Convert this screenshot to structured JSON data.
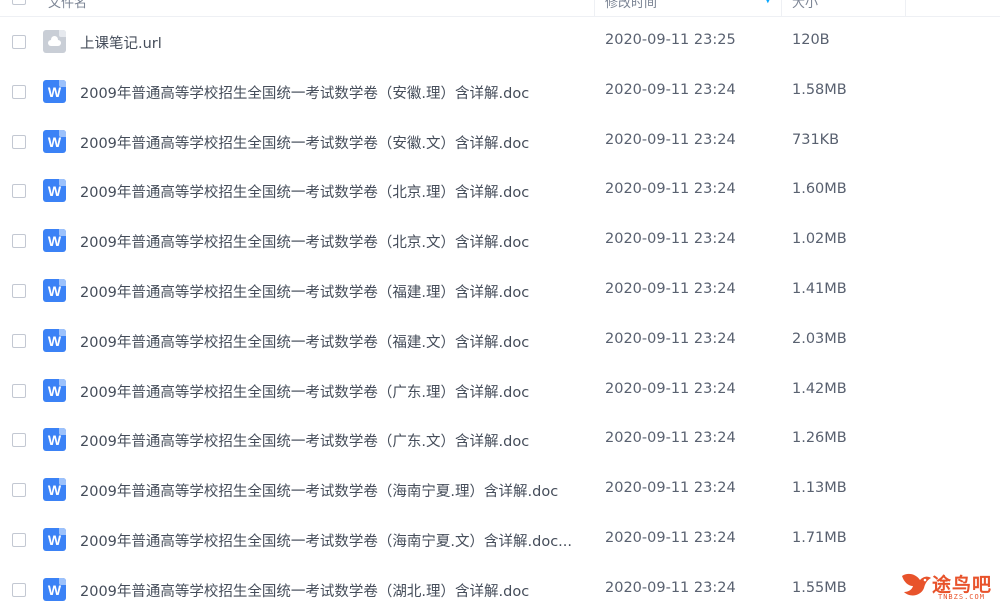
{
  "header": {
    "name_label": "文件名",
    "time_label": "修改时间",
    "size_label": "大小"
  },
  "files": [
    {
      "icon": "url-file-icon",
      "name": "上课笔记.url",
      "time": "2020-09-11 23:25",
      "size": "120B"
    },
    {
      "icon": "word-doc-icon",
      "name": "2009年普通高等学校招生全国统一考试数学卷（安徽.理）含详解.doc",
      "time": "2020-09-11 23:24",
      "size": "1.58MB"
    },
    {
      "icon": "word-doc-icon",
      "name": "2009年普通高等学校招生全国统一考试数学卷（安徽.文）含详解.doc",
      "time": "2020-09-11 23:24",
      "size": "731KB"
    },
    {
      "icon": "word-doc-icon",
      "name": "2009年普通高等学校招生全国统一考试数学卷（北京.理）含详解.doc",
      "time": "2020-09-11 23:24",
      "size": "1.60MB"
    },
    {
      "icon": "word-doc-icon",
      "name": "2009年普通高等学校招生全国统一考试数学卷（北京.文）含详解.doc",
      "time": "2020-09-11 23:24",
      "size": "1.02MB"
    },
    {
      "icon": "word-doc-icon",
      "name": "2009年普通高等学校招生全国统一考试数学卷（福建.理）含详解.doc",
      "time": "2020-09-11 23:24",
      "size": "1.41MB"
    },
    {
      "icon": "word-doc-icon",
      "name": "2009年普通高等学校招生全国统一考试数学卷（福建.文）含详解.doc",
      "time": "2020-09-11 23:24",
      "size": "2.03MB"
    },
    {
      "icon": "word-doc-icon",
      "name": "2009年普通高等学校招生全国统一考试数学卷（广东.理）含详解.doc",
      "time": "2020-09-11 23:24",
      "size": "1.42MB"
    },
    {
      "icon": "word-doc-icon",
      "name": "2009年普通高等学校招生全国统一考试数学卷（广东.文）含详解.doc",
      "time": "2020-09-11 23:24",
      "size": "1.26MB"
    },
    {
      "icon": "word-doc-icon",
      "name": "2009年普通高等学校招生全国统一考试数学卷（海南宁夏.理）含详解.doc",
      "time": "2020-09-11 23:24",
      "size": "1.13MB"
    },
    {
      "icon": "word-doc-icon",
      "name": "2009年普通高等学校招生全国统一考试数学卷（海南宁夏.文）含详解.doc...",
      "time": "2020-09-11 23:24",
      "size": "1.71MB"
    },
    {
      "icon": "word-doc-icon",
      "name": "2009年普通高等学校招生全国统一考试数学卷（湖北.理）含详解.doc",
      "time": "2020-09-11 23:24",
      "size": "1.55MB"
    }
  ],
  "watermark": {
    "title": "途鸟吧",
    "subtitle": "TNBZS.COM",
    "color": "#e8532b"
  },
  "colors": {
    "word_icon": "#3b82f6",
    "sort_accent": "#06a7ff"
  }
}
